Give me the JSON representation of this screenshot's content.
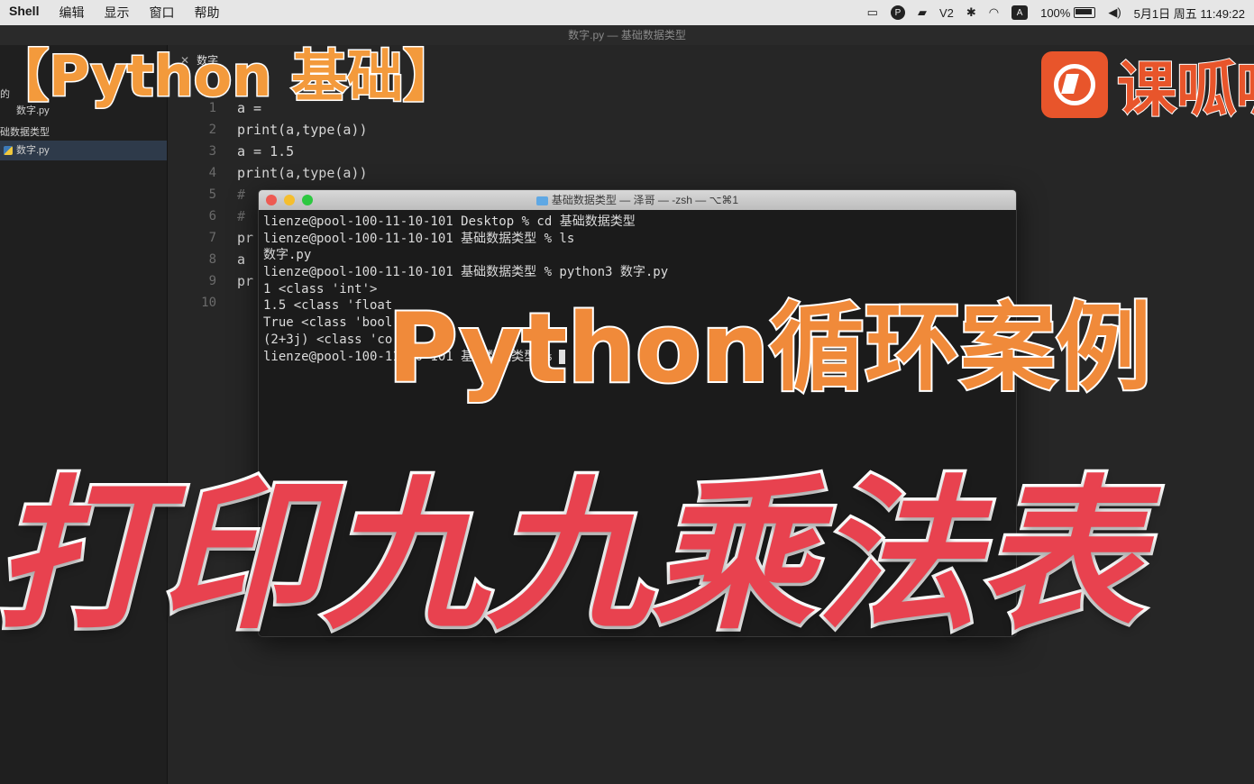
{
  "menubar": {
    "items": [
      "Shell",
      "编辑",
      "显示",
      "窗口",
      "帮助"
    ],
    "status": {
      "v2": "V2",
      "input": "A",
      "battery": "100%",
      "datetime": "5月1日 周五  11:49:22"
    }
  },
  "editor": {
    "window_title": "数字.py — 基础数据类型",
    "tab_label": "数字",
    "sidebar": {
      "row1": "的",
      "row2": "数字.py",
      "row3": "础数据类型",
      "row4": "数字.py"
    },
    "line_numbers": [
      "1",
      "2",
      "3",
      "4",
      "5",
      "6",
      "7",
      "8",
      "9",
      "10"
    ],
    "code_lines": [
      "a = ",
      "print(a,type(a))",
      "a = 1.5",
      "print(a,type(a))",
      "#",
      "#",
      "pr",
      "a",
      "pr",
      ""
    ]
  },
  "terminal": {
    "title": "基础数据类型 — 泽哥 — -zsh — ⌥⌘1",
    "lines": [
      "lienze@pool-100-11-10-101 Desktop % cd 基础数据类型",
      "lienze@pool-100-11-10-101 基础数据类型 % ls",
      "数字.py",
      "lienze@pool-100-11-10-101 基础数据类型 % python3 数字.py",
      "1 <class 'int'>",
      "1.5 <class 'float",
      "True <class 'bool",
      "(2+3j) <class 'co",
      "lienze@pool-100-11-10-101 基础数据类型 % "
    ]
  },
  "overlay": {
    "tag": "【Python 基础】",
    "subtitle": "Python循环案例",
    "headline": "打印九九乘法表"
  },
  "logo": {
    "text": "课呱呱"
  }
}
